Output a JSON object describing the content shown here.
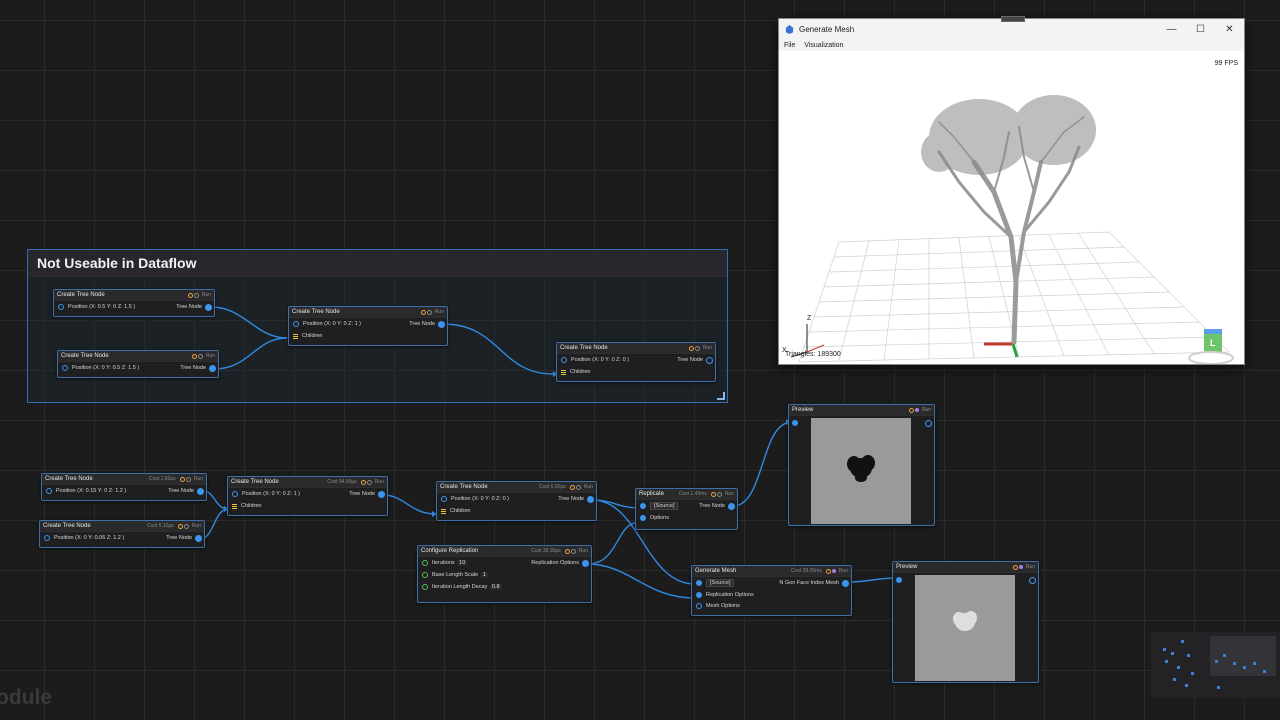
{
  "group": {
    "title": "Not Useable in Dataflow"
  },
  "labels": {
    "run": "Run",
    "tree_node": "Tree Node",
    "children": "Children",
    "position": "Position",
    "source": "[Source]",
    "options": "Options",
    "replication_options": "Replication Options",
    "mesh_options": "Mesh Options",
    "ngon_mesh": "N Gon Face Index Mesh",
    "iterations": "Iterations",
    "base_length_scale": "Base Length Scale",
    "iteration_length_decay": "Iteration Length Decay"
  },
  "nodes": {
    "g1": {
      "title": "Create Tree Node",
      "pos": "(X: 0.5 Y: 0 Z: 1.5 )"
    },
    "g2": {
      "title": "Create Tree Node",
      "pos": "(X: 0 Y: 0.5 Z: 1.5 )"
    },
    "g3": {
      "title": "Create Tree Node",
      "pos": "(X: 0 Y: 0 Z: 1 )"
    },
    "g4": {
      "title": "Create Tree Node",
      "pos": "(X: 0 Y: 0 Z: 0 )"
    },
    "n1": {
      "title": "Create Tree Node",
      "cost": "Cost 1.60µs",
      "pos": "(X: 0.15 Y: 0 Z: 1.2 )"
    },
    "n2": {
      "title": "Create Tree Node",
      "cost": "Cost 5.10µs",
      "pos": "(X: 0 Y: 0.06 Z: 1.2 )"
    },
    "n3": {
      "title": "Create Tree Node",
      "cost": "Cost 54.50µs",
      "pos": "(X: 0 Y: 0 Z: 1 )"
    },
    "n4": {
      "title": "Create Tree Node",
      "cost": "Cost 6.50µs",
      "pos": "(X: 0 Y: 0 Z: 0 )"
    },
    "rep": {
      "title": "Replicate",
      "cost": "Cost 1.49ms"
    },
    "cfg": {
      "title": "Configure Replication",
      "cost": "Cost 39.30µs",
      "iterations": "10",
      "base": "1",
      "decay": "0.8"
    },
    "gm": {
      "title": "Generate Mesh",
      "cost": "Cost 28.05ms"
    },
    "pv1": {
      "title": "Preview"
    },
    "pv2": {
      "title": "Preview"
    }
  },
  "window": {
    "title": "Generate Mesh",
    "menu": [
      "File",
      "Visualization"
    ],
    "fps": "99 FPS",
    "triangles": "Triangles: 189300",
    "axes": {
      "z": "Z",
      "x": "X"
    },
    "cube_label": "L"
  },
  "watermark": "odule",
  "colors": {
    "accent": "#3b97f0",
    "border": "#3d6fa8",
    "orange": "#e8a33c",
    "purple": "#a87be8",
    "green": "#5bbf54"
  }
}
